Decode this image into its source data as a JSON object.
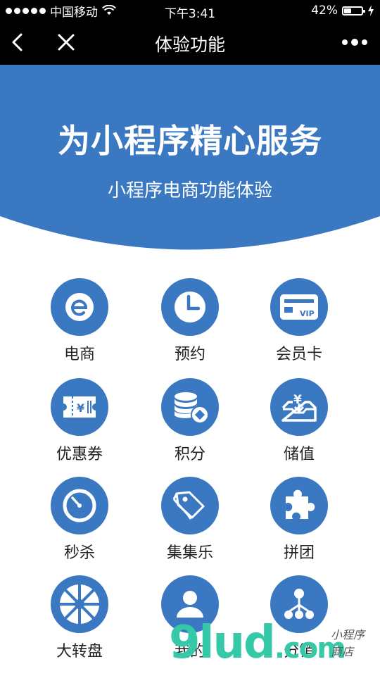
{
  "status_bar": {
    "carrier": "中国移动",
    "time": "下午3:41",
    "battery": "42%",
    "battery_level": 0.42
  },
  "nav": {
    "title": "体验功能",
    "icons": [
      "back-arrow-icon",
      "close-icon",
      "more-icon"
    ]
  },
  "banner": {
    "title": "为小程序精心服务",
    "subtitle": "小程序电商功能体验",
    "color": "#3a78c2"
  },
  "features": [
    {
      "label": "电商",
      "icon": "ecommerce-icon"
    },
    {
      "label": "预约",
      "icon": "clock-icon"
    },
    {
      "label": "会员卡",
      "icon": "vip-card-icon"
    },
    {
      "label": "优惠券",
      "icon": "coupon-icon"
    },
    {
      "label": "积分",
      "icon": "coins-icon"
    },
    {
      "label": "储值",
      "icon": "deposit-icon"
    },
    {
      "label": "秒杀",
      "icon": "timer-icon"
    },
    {
      "label": "集集乐",
      "icon": "tags-icon"
    },
    {
      "label": "拼团",
      "icon": "puzzle-icon"
    },
    {
      "label": "大转盘",
      "icon": "wheel-icon"
    },
    {
      "label": "我的",
      "icon": "user-icon"
    },
    {
      "label": "分销",
      "icon": "distribution-icon"
    }
  ],
  "watermark": {
    "text": "9lud",
    "domain": ".com",
    "small": "小程序商店"
  }
}
